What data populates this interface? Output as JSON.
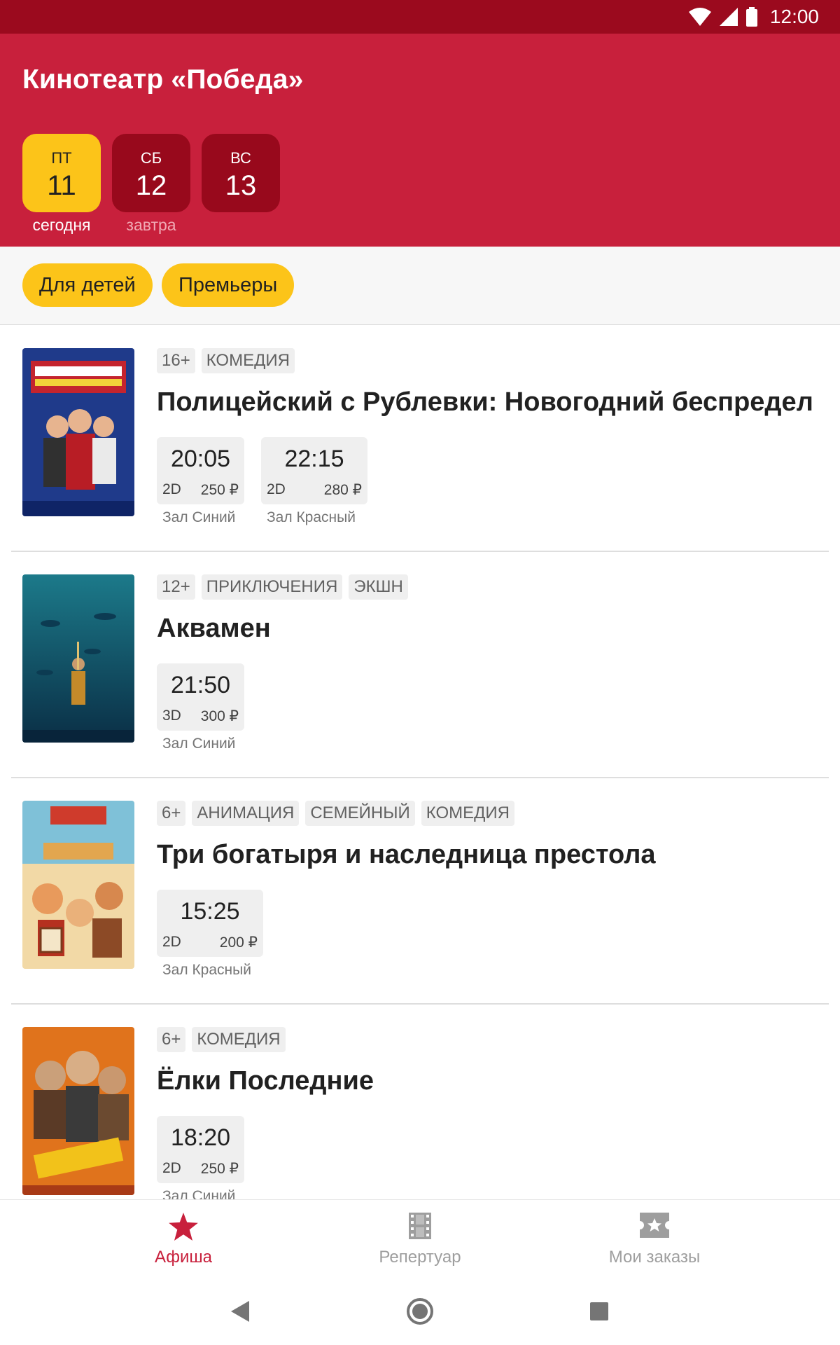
{
  "status_bar": {
    "time": "12:00"
  },
  "header": {
    "title": "Кинотеатр «Победа»",
    "dates": [
      {
        "dow": "ПТ",
        "day": "11",
        "caption": "сегодня",
        "selected": true
      },
      {
        "dow": "СБ",
        "day": "12",
        "caption": "завтра",
        "selected": false
      },
      {
        "dow": "ВС",
        "day": "13",
        "caption": "",
        "selected": false
      }
    ]
  },
  "filters": [
    "Для детей",
    "Премьеры"
  ],
  "movies": [
    {
      "tags": [
        "16+",
        "КОМЕДИЯ"
      ],
      "title": "Полицейский с Рублевки: Новогодний беспредел",
      "poster_colors": [
        "#2f4e9c",
        "#c4242e"
      ],
      "sessions": [
        {
          "time": "20:05",
          "format": "2D",
          "price": "250 ₽",
          "hall": "Зал Синий"
        },
        {
          "time": "22:15",
          "format": "2D",
          "price": "280 ₽",
          "hall": "Зал Красный"
        }
      ]
    },
    {
      "tags": [
        "12+",
        "ПРИКЛЮЧЕНИЯ",
        "ЭКШН"
      ],
      "title": "Аквамен",
      "poster_colors": [
        "#0f4a63",
        "#1c7a8a"
      ],
      "sessions": [
        {
          "time": "21:50",
          "format": "3D",
          "price": "300 ₽",
          "hall": "Зал Синий"
        }
      ]
    },
    {
      "tags": [
        "6+",
        "АНИМАЦИЯ",
        "СЕМЕЙНЫЙ",
        "КОМЕДИЯ"
      ],
      "title": "Три богатыря и наследница престола",
      "poster_colors": [
        "#cf3b2c",
        "#e2a64f"
      ],
      "sessions": [
        {
          "time": "15:25",
          "format": "2D",
          "price": "200 ₽",
          "hall": "Зал Красный"
        }
      ]
    },
    {
      "tags": [
        "6+",
        "КОМЕДИЯ"
      ],
      "title": "Ёлки Последние",
      "poster_colors": [
        "#e0731c",
        "#a83a16"
      ],
      "sessions": [
        {
          "time": "18:20",
          "format": "2D",
          "price": "250 ₽",
          "hall": "Зал Синий"
        }
      ]
    }
  ],
  "bottom_nav": [
    {
      "label": "Афиша",
      "icon": "star-icon",
      "active": true
    },
    {
      "label": "Репертуар",
      "icon": "film-icon",
      "active": false
    },
    {
      "label": "Мои заказы",
      "icon": "ticket-icon",
      "active": false
    }
  ],
  "colors": {
    "brand": "#c8203c",
    "accent": "#fcc419",
    "status_bar": "#9b0a1e"
  }
}
